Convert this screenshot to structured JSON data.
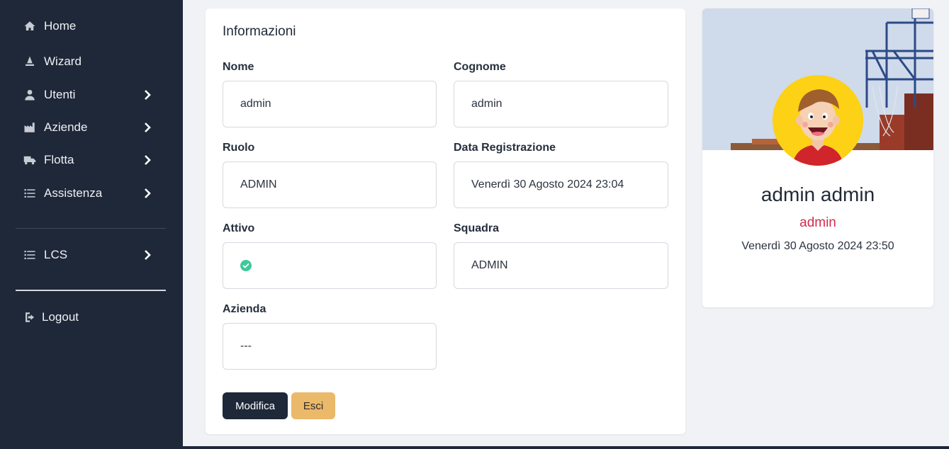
{
  "sidebar": {
    "items": [
      {
        "label": "Home",
        "icon": "home-icon",
        "has_chevron": false
      },
      {
        "label": "Wizard",
        "icon": "wizard-icon",
        "has_chevron": false
      },
      {
        "label": "Utenti",
        "icon": "user-icon",
        "has_chevron": true
      },
      {
        "label": "Aziende",
        "icon": "factory-icon",
        "has_chevron": true
      },
      {
        "label": "Flotta",
        "icon": "truck-icon",
        "has_chevron": true
      },
      {
        "label": "Assistenza",
        "icon": "list-icon",
        "has_chevron": true
      }
    ],
    "lcs": {
      "label": "LCS",
      "icon": "list-icon",
      "has_chevron": true
    },
    "logout": {
      "label": "Logout",
      "icon": "logout-icon"
    }
  },
  "form": {
    "title": "Informazioni",
    "fields": {
      "nome": {
        "label": "Nome",
        "value": "admin"
      },
      "cognome": {
        "label": "Cognome",
        "value": "admin"
      },
      "ruolo": {
        "label": "Ruolo",
        "value": "ADMIN"
      },
      "data_registrazione": {
        "label": "Data Registrazione",
        "value": "Venerdì 30 Agosto 2024 23:04"
      },
      "attivo": {
        "label": "Attivo",
        "value": "check-circle-icon"
      },
      "squadra": {
        "label": "Squadra",
        "value": "ADMIN"
      },
      "azienda": {
        "label": "Azienda",
        "value": "---"
      }
    },
    "buttons": {
      "edit": "Modifica",
      "exit": "Esci"
    }
  },
  "profile": {
    "name": "admin admin",
    "role": "admin",
    "date": "Venerdì 30 Agosto 2024 23:50"
  },
  "colors": {
    "sidebar_bg": "#1f2839",
    "accent_amber": "#ebb96a",
    "role_red": "#d22c4c",
    "active_green": "#3ec99a",
    "avatar_yellow": "#fcd116"
  }
}
